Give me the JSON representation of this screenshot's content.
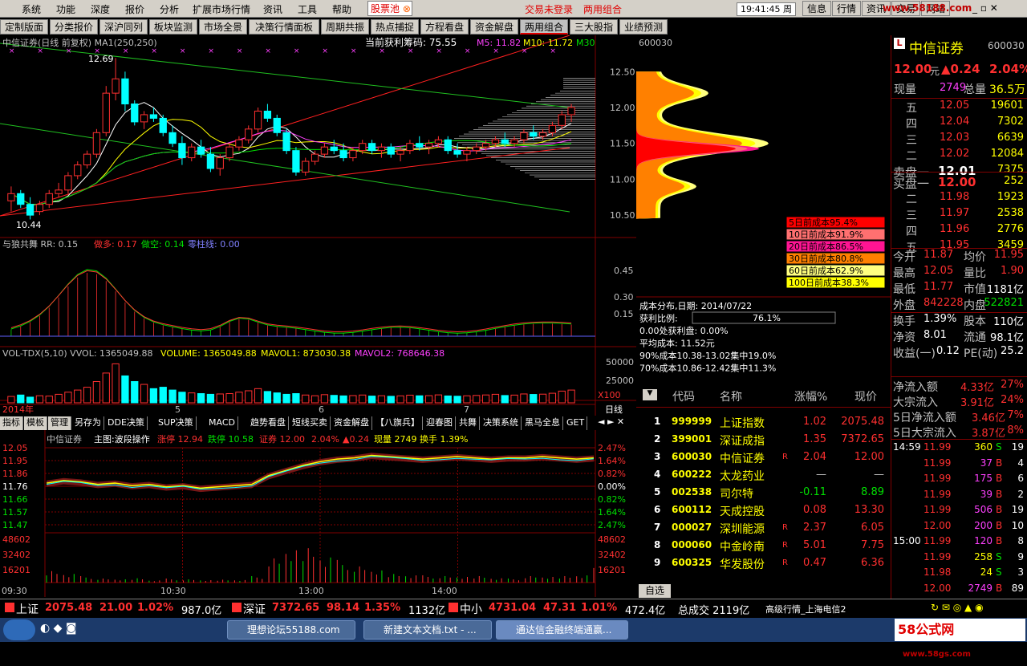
{
  "menu": [
    "系统",
    "功能",
    "深度",
    "报价",
    "分析",
    "扩展市场行情",
    "资讯",
    "工具",
    "帮助"
  ],
  "menu_special": "股票池",
  "menu_status": "交易未登录",
  "menu_status2": "两用组合",
  "clock": "19:41:45 周二",
  "right_buttons": [
    "信息",
    "行情",
    "资讯",
    "交易",
    "网站"
  ],
  "watermark_url": "www.58188.com",
  "tabs": [
    "定制版面",
    "分类报价",
    "深沪同列",
    "板块监测",
    "市场全景",
    "决策行情面板",
    "周期共振",
    "热点捕捉",
    "方程看盘",
    "资金解盘",
    "两用组合",
    "三大股指",
    "业绩预测"
  ],
  "active_tab": "两用组合",
  "main_chart": {
    "title": "中信证券(日线 前复权) MA1(250,250)",
    "chip_profit": "当前获利筹码: 75.55",
    "ma5": "M5: 11.82",
    "ma10": "M10: 11.72",
    "ma30": "M30",
    "high_label": "12.69",
    "low_label": "10.44",
    "ytick": [
      "12.50",
      "12.00",
      "11.50",
      "11.00",
      "10.50"
    ],
    "ticks_values": [
      12.5,
      12.0,
      11.5,
      11.0,
      10.5
    ],
    "ylim": [
      10.3,
      12.85
    ]
  },
  "chart_data": {
    "type": "candlestick",
    "title": "中信证券(日线 前复权)",
    "ylim": [
      10.3,
      12.85
    ],
    "candles": [
      [
        10.7,
        10.9,
        10.55,
        10.8
      ],
      [
        10.8,
        10.85,
        10.6,
        10.65
      ],
      [
        10.65,
        10.75,
        10.44,
        10.5
      ],
      [
        10.55,
        10.7,
        10.5,
        10.65
      ],
      [
        10.65,
        10.85,
        10.6,
        10.8
      ],
      [
        10.8,
        10.95,
        10.75,
        10.85
      ],
      [
        10.85,
        11.1,
        10.8,
        11.05
      ],
      [
        11.05,
        11.25,
        11.0,
        11.2
      ],
      [
        11.2,
        11.4,
        11.15,
        11.35
      ],
      [
        11.35,
        11.7,
        11.3,
        11.65
      ],
      [
        11.65,
        12.3,
        11.6,
        12.2
      ],
      [
        12.2,
        12.69,
        12.1,
        12.4
      ],
      [
        12.4,
        12.5,
        11.95,
        12.05
      ],
      [
        12.05,
        12.1,
        11.75,
        11.8
      ],
      [
        11.8,
        11.95,
        11.7,
        11.9
      ],
      [
        11.9,
        12.0,
        11.8,
        11.85
      ],
      [
        11.85,
        11.9,
        11.6,
        11.65
      ],
      [
        11.65,
        11.75,
        11.45,
        11.5
      ],
      [
        11.5,
        11.6,
        11.2,
        11.3
      ],
      [
        11.3,
        11.5,
        11.25,
        11.45
      ],
      [
        11.45,
        11.55,
        11.3,
        11.35
      ],
      [
        11.35,
        11.45,
        11.1,
        11.15
      ],
      [
        11.15,
        11.35,
        11.05,
        11.3
      ],
      [
        11.3,
        11.5,
        11.25,
        11.45
      ],
      [
        11.45,
        11.6,
        11.4,
        11.55
      ],
      [
        11.55,
        11.75,
        11.5,
        11.7
      ],
      [
        11.7,
        12.0,
        11.65,
        11.95
      ],
      [
        11.95,
        12.05,
        11.8,
        11.85
      ],
      [
        11.85,
        11.9,
        11.6,
        11.65
      ],
      [
        11.65,
        11.7,
        11.35,
        11.4
      ],
      [
        11.4,
        11.45,
        11.05,
        11.1
      ],
      [
        11.1,
        11.3,
        11.05,
        11.25
      ],
      [
        11.25,
        11.4,
        11.2,
        11.35
      ],
      [
        11.35,
        11.5,
        11.3,
        11.45
      ],
      [
        11.45,
        11.55,
        11.35,
        11.4
      ],
      [
        11.4,
        11.5,
        11.25,
        11.3
      ],
      [
        11.3,
        11.45,
        11.25,
        11.4
      ],
      [
        11.4,
        11.55,
        11.35,
        11.5
      ],
      [
        11.5,
        11.55,
        11.35,
        11.4
      ],
      [
        11.4,
        11.5,
        11.3,
        11.45
      ],
      [
        11.45,
        11.5,
        11.3,
        11.35
      ],
      [
        11.35,
        11.45,
        11.25,
        11.4
      ],
      [
        11.4,
        11.55,
        11.35,
        11.5
      ],
      [
        11.5,
        11.6,
        11.4,
        11.45
      ],
      [
        11.45,
        11.55,
        11.35,
        11.5
      ],
      [
        11.5,
        11.6,
        11.45,
        11.55
      ],
      [
        11.55,
        11.6,
        11.35,
        11.4
      ],
      [
        11.4,
        11.5,
        11.3,
        11.35
      ],
      [
        11.35,
        11.45,
        11.25,
        11.4
      ],
      [
        11.4,
        11.5,
        11.35,
        11.45
      ],
      [
        11.45,
        11.55,
        11.4,
        11.5
      ],
      [
        11.5,
        11.6,
        11.45,
        11.55
      ],
      [
        11.55,
        11.65,
        11.45,
        11.5
      ],
      [
        11.5,
        11.6,
        11.45,
        11.55
      ],
      [
        11.55,
        11.7,
        11.5,
        11.65
      ],
      [
        11.65,
        11.75,
        11.55,
        11.6
      ],
      [
        11.6,
        11.7,
        11.55,
        11.65
      ],
      [
        11.65,
        11.8,
        11.6,
        11.75
      ],
      [
        11.75,
        11.95,
        11.7,
        11.9
      ],
      [
        11.9,
        12.05,
        11.8,
        12.0
      ]
    ],
    "vol_ylim": [
      0,
      60000
    ],
    "vol_ticks": [
      "50000",
      "25000"
    ],
    "vol_unit": "X100",
    "volumes": [
      9000,
      11000,
      8000,
      10000,
      9500,
      12000,
      15000,
      18000,
      22000,
      30000,
      42000,
      55000,
      38000,
      30000,
      26000,
      20000,
      22000,
      18000,
      15000,
      14000,
      13000,
      12000,
      12500,
      13000,
      15000,
      17000,
      20000,
      16000,
      14000,
      12000,
      13000,
      11000,
      10000,
      11500,
      10500,
      9800,
      10200,
      11000,
      9500,
      10000,
      9200,
      9800,
      10800,
      9900,
      10100,
      11200,
      9700,
      9300,
      9900,
      10400,
      11100,
      12000,
      10300,
      10900,
      12500,
      11800,
      12200,
      13500,
      16500,
      18000
    ]
  },
  "chip": {
    "code": "600030",
    "legend": [
      "5日前成本95.4%",
      "10日前成本91.9%",
      "20日前成本86.5%",
      "30日前成本80.8%",
      "60日前成本62.9%",
      "100日前成本38.3%"
    ],
    "legend_colors": [
      "#ff0000",
      "#ff7070",
      "#ff1493",
      "#ff8000",
      "#ffff80",
      "#ffff00"
    ],
    "info": [
      "成本分布,日期: 2014/07/22",
      "获利比例:",
      "0.00处获利盘: 0.00%",
      "平均成本: 11.52元",
      "90%成本10.38-13.02集中19.0%",
      "70%成本10.86-12.42集中11.3%"
    ],
    "profit_ratio": "76.1%"
  },
  "osc": {
    "title": "与狼共舞 RR: 0.15",
    "l1": "做多: 0.17",
    "l2": "做空: 0.14",
    "l3": "零柱线: 0.00",
    "ytick": [
      "0.45",
      "0.30",
      "0.15"
    ]
  },
  "vol": {
    "title": "VOL-TDX(5,10) VVOL: 1365049.88",
    "l1": "VOLUME: 1365049.88",
    "l2": "MAVOL1: 873030.38",
    "l3": "MAVOL2: 768646.38"
  },
  "xaxis": {
    "labels": [
      "2014年",
      "5",
      "6",
      "7"
    ],
    "period": "日线"
  },
  "subtabs": [
    "指标",
    "模板",
    "管理",
    "另存为",
    "DDE决策",
    "SUP决策",
    "MACD",
    "趋势看盘",
    "短线买卖",
    "资金解盘",
    "【八旗兵】",
    "迎春图",
    "共舞",
    "决策系统",
    "黑马全息",
    "GET"
  ],
  "intraday": {
    "header": "中信证券",
    "l0": "主图:波段操作",
    "l1": "涨停 12.94",
    "l2": "跌停 10.58",
    "l3": "证券 12.00",
    "l4": "2.04%",
    "l5": "▲0.24",
    "l6": "现量 2749",
    "l7": "换手 1.39%",
    "left_ticks": [
      "12.05",
      "11.95",
      "11.86",
      "11.76",
      "11.66",
      "11.57",
      "11.47"
    ],
    "right_ticks": [
      "2.47%",
      "1.64%",
      "0.82%",
      "0.00%",
      "0.82%",
      "1.64%",
      "2.47%"
    ],
    "vol_ticks": [
      "48602",
      "32402",
      "16201"
    ],
    "time_labels": [
      "09:30",
      "10:30",
      "13:00",
      "14:00"
    ],
    "prices": [
      11.8,
      11.82,
      11.81,
      11.79,
      11.8,
      11.78,
      11.79,
      11.77,
      11.78,
      11.76,
      11.77,
      11.78,
      11.79,
      11.86,
      11.9,
      11.94,
      11.97,
      11.99,
      12.0,
      12.02,
      12.01,
      12.0,
      11.99,
      12.0,
      12.01,
      12.0,
      11.99,
      12.0,
      12.0,
      12.01,
      12.0,
      11.99,
      12.0
    ],
    "vols": [
      16000,
      12000,
      8000,
      5000,
      4000,
      6000,
      3000,
      5000,
      4000,
      3000,
      4000,
      3500,
      8000,
      30000,
      40000,
      48000,
      35000,
      28000,
      20000,
      15000,
      12000,
      10000,
      9000,
      8000,
      7000,
      9000,
      6000,
      5000,
      8000,
      7000,
      9000,
      10000,
      18000
    ],
    "ylim": [
      11.47,
      12.08
    ]
  },
  "quote": {
    "name": "中信证券",
    "code": "600030",
    "price": "12.00",
    "unit": "元",
    "change": "▲0.24",
    "pct": "2.04%",
    "now_vol_label": "现量",
    "now_vol": "2749",
    "total_label": "总量",
    "total": "36.5万",
    "asks": [
      [
        "五",
        "12.05",
        "19601"
      ],
      [
        "四",
        "12.04",
        "7302"
      ],
      [
        "三",
        "12.03",
        "6639"
      ],
      [
        "二",
        "12.02",
        "12084"
      ],
      [
        "卖盘一",
        "12.01",
        "7375"
      ]
    ],
    "bids": [
      [
        "买盘一",
        "12.00",
        "252"
      ],
      [
        "二",
        "11.98",
        "1923"
      ],
      [
        "三",
        "11.97",
        "2538"
      ],
      [
        "四",
        "11.96",
        "2776"
      ],
      [
        "五",
        "11.95",
        "3459"
      ]
    ],
    "stats": [
      [
        "今开",
        "11.87",
        "均价",
        "11.95"
      ],
      [
        "最高",
        "12.05",
        "量比",
        "1.90"
      ],
      [
        "最低",
        "11.77",
        "市值",
        "1181亿"
      ],
      [
        "外盘",
        "842228",
        "内盘",
        "522821"
      ],
      [
        "换手",
        "1.39%",
        "股本",
        "110亿"
      ],
      [
        "净资",
        "8.01",
        "流通",
        "98.1亿"
      ],
      [
        "收益(一)",
        "0.12",
        "PE(动)",
        "25.2"
      ]
    ],
    "flows": [
      [
        "净流入额",
        "4.33亿",
        "27%"
      ],
      [
        "大宗流入",
        "3.91亿",
        "24%"
      ],
      [
        "5日净流入额",
        "3.46亿",
        "7%"
      ],
      [
        "5日大宗流入",
        "3.87亿",
        "8%"
      ]
    ],
    "ticks": [
      [
        "14:59",
        "11.99",
        "360",
        "S",
        "19"
      ],
      [
        "",
        "11.99",
        "37",
        "B",
        "4"
      ],
      [
        "",
        "11.99",
        "175",
        "B",
        "6"
      ],
      [
        "",
        "11.99",
        "39",
        "B",
        "2"
      ],
      [
        "",
        "11.99",
        "506",
        "B",
        "19"
      ],
      [
        "",
        "12.00",
        "200",
        "B",
        "10"
      ],
      [
        "15:00",
        "11.99",
        "120",
        "B",
        "8"
      ],
      [
        "",
        "11.99",
        "258",
        "S",
        "9"
      ],
      [
        "",
        "11.98",
        "24",
        "S",
        "3"
      ],
      [
        "",
        "12.00",
        "2749",
        "B",
        "89"
      ]
    ]
  },
  "watchlist": {
    "headers": [
      "代码",
      "名称",
      "涨幅%",
      "现价"
    ],
    "rows": [
      [
        "1",
        "999999",
        "上证指数",
        "",
        "1.02",
        "2075.48"
      ],
      [
        "2",
        "399001",
        "深证成指",
        "",
        "1.35",
        "7372.65"
      ],
      [
        "3",
        "600030",
        "中信证券",
        "R",
        "2.04",
        "12.00"
      ],
      [
        "4",
        "600222",
        "太龙药业",
        "",
        "—",
        "—"
      ],
      [
        "5",
        "002538",
        "司尔特",
        "",
        "-0.11",
        "8.89"
      ],
      [
        "6",
        "600112",
        "天成控股",
        "",
        "0.08",
        "13.30"
      ],
      [
        "7",
        "000027",
        "深圳能源",
        "R",
        "2.37",
        "6.05"
      ],
      [
        "8",
        "000060",
        "中金岭南",
        "R",
        "5.01",
        "7.75"
      ],
      [
        "9",
        "600325",
        "华发股份",
        "R",
        "0.47",
        "6.36"
      ]
    ],
    "tab": "自选"
  },
  "bottom_ticker": [
    [
      "上证",
      "2075.48",
      "21.00",
      "1.02%",
      "987.0亿"
    ],
    [
      "深证",
      "7372.65",
      "98.14",
      "1.35%",
      "1132亿"
    ],
    [
      "中小",
      "4731.04",
      "47.31",
      "1.01%",
      "472.4亿"
    ]
  ],
  "bottom_total": "总成交 2119亿",
  "bottom_status": "高级行情_上海电信2",
  "taskbar": [
    "理想论坛55188.com",
    "新建文本文档.txt - ...",
    "通达信金融终端通赢..."
  ],
  "brand": "58公式网",
  "brand_url": "www.58gs.com"
}
